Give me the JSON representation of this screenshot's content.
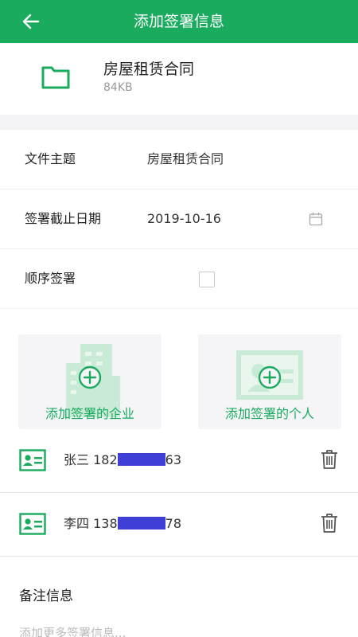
{
  "header": {
    "title": "添加签署信息",
    "back_icon": "arrow-left-icon"
  },
  "file": {
    "name": "房屋租赁合同",
    "size": "84KB",
    "icon": "folder-icon"
  },
  "form": {
    "subject": {
      "label": "文件主题",
      "value": "房屋租赁合同"
    },
    "deadline": {
      "label": "签署截止日期",
      "value": "2019-10-16",
      "icon": "calendar-icon"
    },
    "sequential": {
      "label": "顺序签署",
      "checked": false
    }
  },
  "actions": {
    "add_company": "添加签署的企业",
    "add_person": "添加签署的个人"
  },
  "signers": [
    {
      "name_prefix": "张三 182",
      "name_suffix": "63"
    },
    {
      "name_prefix": "李四 138",
      "name_suffix": "78"
    }
  ],
  "notes": {
    "title": "备注信息",
    "placeholder": "添加更多签署信息..."
  },
  "colors": {
    "accent": "#1aab5f",
    "mask": "#3f3fd8",
    "divider": "#f3f3f5"
  }
}
